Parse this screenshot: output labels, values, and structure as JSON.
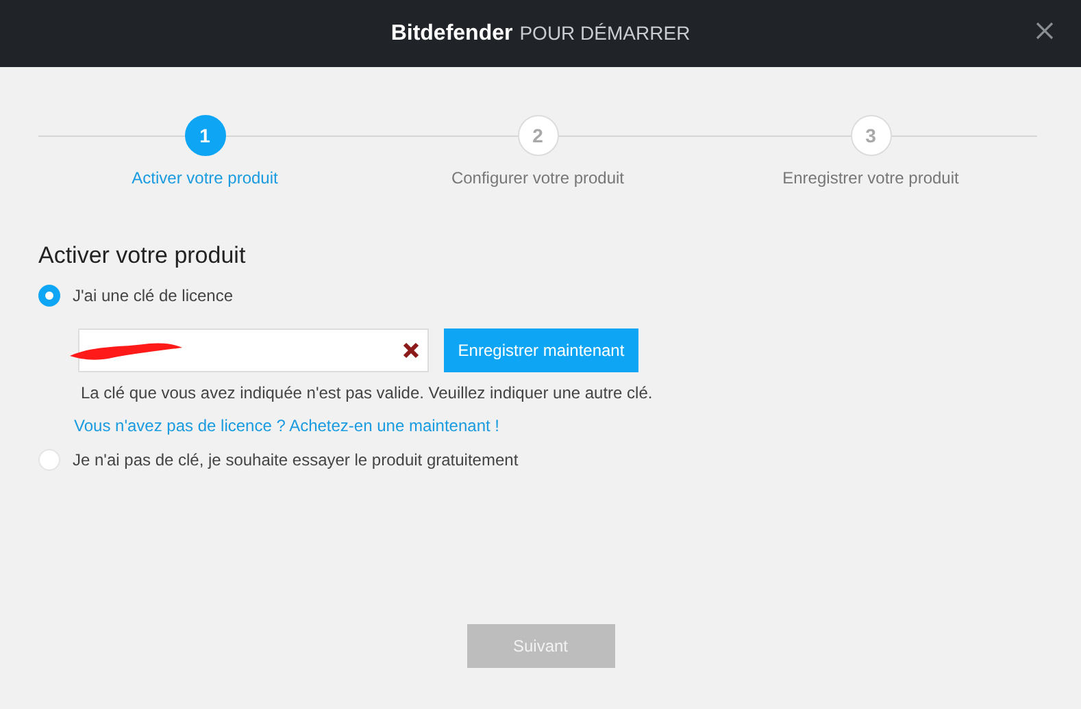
{
  "header": {
    "brand": "Bitdefender",
    "title": "POUR DÉMARRER"
  },
  "steps": [
    {
      "number": "1",
      "label": "Activer votre produit",
      "selected": true
    },
    {
      "number": "2",
      "label": "Configurer votre produit",
      "selected": false
    },
    {
      "number": "3",
      "label": "Enregistrer votre produit",
      "selected": false
    }
  ],
  "heading": "Activer votre produit",
  "options": [
    {
      "label": "J'ai une clé de licence",
      "selected": true
    },
    {
      "label": "Je n'ai pas de clé, je souhaite essayer le produit gratuitement",
      "selected": false
    }
  ],
  "license": {
    "invalid": true,
    "button": "Enregistrer maintenant",
    "error": "La clé que vous avez indiquée n'est pas valide. Veuillez indiquer une autre clé.",
    "link": "Vous n'avez pas de licence ? Achetez-en une maintenant !"
  },
  "next_button": {
    "label": "Suivant",
    "disabled": true
  }
}
